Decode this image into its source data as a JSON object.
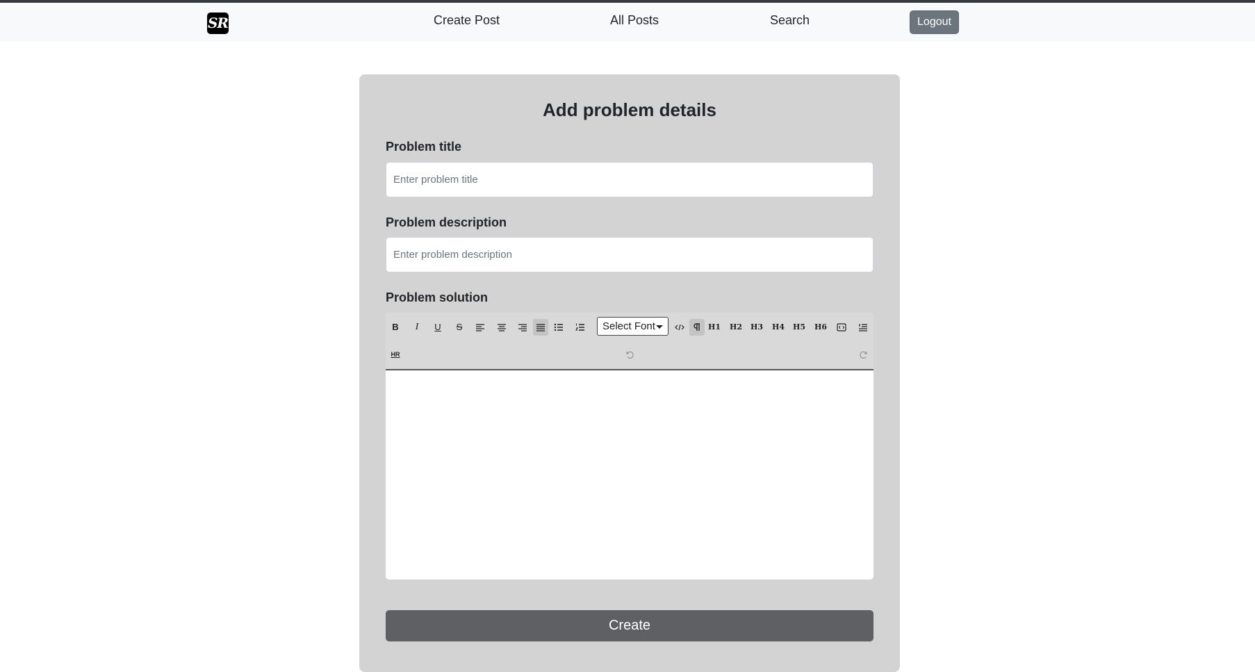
{
  "brand": {
    "logo_text": "SR"
  },
  "nav": {
    "create_post": "Create Post",
    "all_posts": "All Posts",
    "search": "Search",
    "logout": "Logout"
  },
  "form": {
    "title": "Add problem details",
    "problem_title_label": "Problem title",
    "problem_title_placeholder": "Enter problem title",
    "problem_description_label": "Problem description",
    "problem_description_placeholder": "Enter problem description",
    "problem_solution_label": "Problem solution",
    "create_label": "Create"
  },
  "editor_toolbar": {
    "font_select_label": "Select Font",
    "buttons": {
      "bold": "B",
      "italic": "I",
      "underline": "U",
      "strike": "S",
      "h1": "H1",
      "h2": "H2",
      "h3": "H3",
      "h4": "H4",
      "h5": "H5",
      "h6": "H6",
      "hr": "HR"
    },
    "active": [
      "justify",
      "paragraph"
    ]
  }
}
